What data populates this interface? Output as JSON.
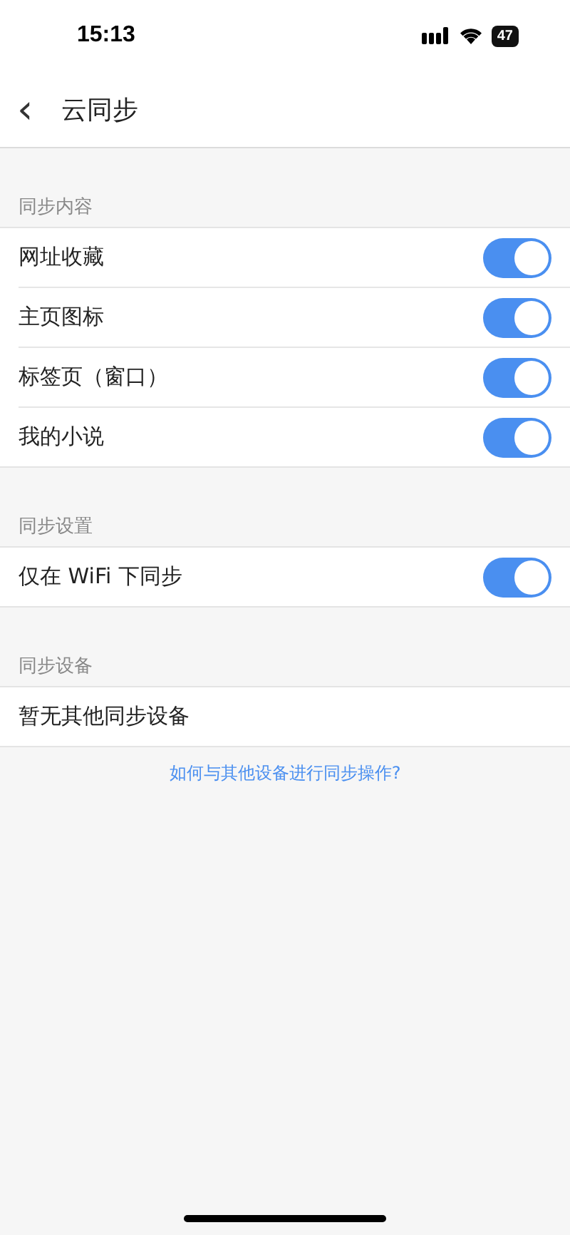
{
  "status_bar": {
    "time": "15:13",
    "battery": "47"
  },
  "nav": {
    "back": "‹",
    "title": "云同步"
  },
  "sections": [
    {
      "header": "同步内容",
      "rows": [
        {
          "kind": "toggle",
          "label": "网址收藏",
          "on": true
        },
        {
          "kind": "toggle",
          "label": "主页图标",
          "on": true
        },
        {
          "kind": "toggle",
          "label": "标签页（窗口）",
          "on": true
        },
        {
          "kind": "toggle",
          "label": "我的小说",
          "on": true
        }
      ]
    },
    {
      "header": "同步设置",
      "rows": [
        {
          "kind": "toggle",
          "label": "仅在 WiFi 下同步",
          "on": true
        }
      ]
    },
    {
      "header": "同步设备",
      "rows": [
        {
          "kind": "text",
          "label": "暂无其他同步设备"
        }
      ]
    }
  ],
  "help_link": "如何与其他设备进行同步操作?"
}
